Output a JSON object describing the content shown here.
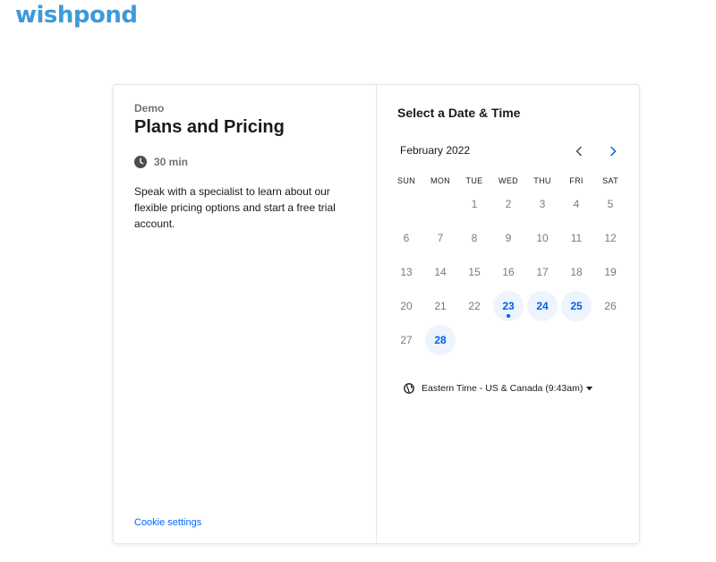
{
  "brand": {
    "logo_text": "wishpond"
  },
  "event": {
    "organizer": "Demo",
    "title": "Plans and Pricing",
    "duration": "30 min",
    "description": "Speak with a specialist to learn about our flexible pricing options and start a free trial account.",
    "cookie_link": "Cookie settings"
  },
  "calendar": {
    "heading": "Select a Date & Time",
    "month_label": "February 2022",
    "weekdays": [
      "SUN",
      "MON",
      "TUE",
      "WED",
      "THU",
      "FRI",
      "SAT"
    ],
    "first_weekday_index": 2,
    "days_in_month": 28,
    "available_days": [
      23,
      24,
      25,
      28
    ],
    "today": 23,
    "accent_color": "#0060e6",
    "available_bg": "#edf4fe"
  },
  "timezone": {
    "label": "Eastern Time - US & Canada (9:43am)"
  }
}
